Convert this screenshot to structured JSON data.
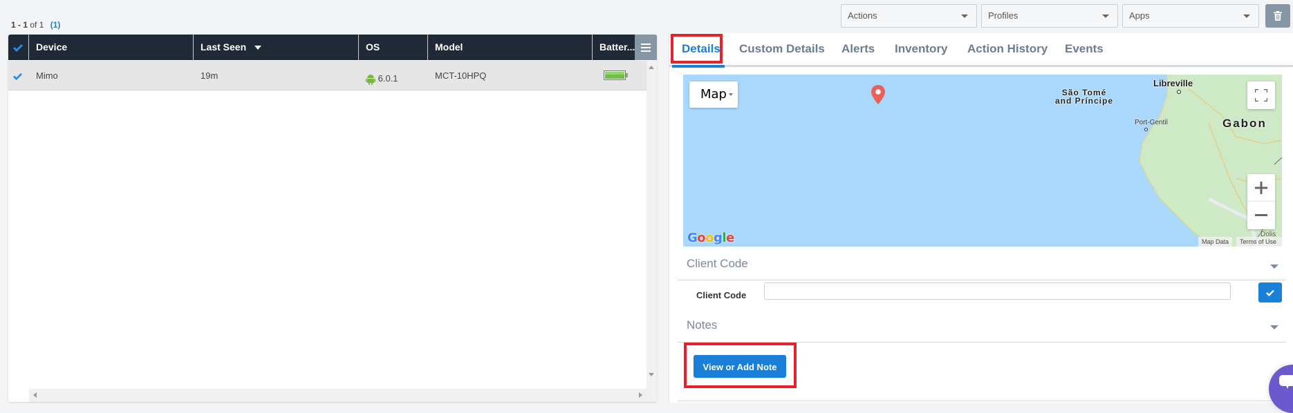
{
  "toolbar": {
    "actions_label": "Actions",
    "profiles_label": "Profiles",
    "apps_label": "Apps",
    "delete_icon": "trash-icon"
  },
  "pagination": {
    "range": "1 - 1",
    "of_text": "of 1",
    "selected_count": "(1)"
  },
  "grid": {
    "columns": [
      {
        "label": "Device"
      },
      {
        "label": "Last Seen",
        "sorted": "desc"
      },
      {
        "label": "OS"
      },
      {
        "label": "Model"
      },
      {
        "label": "Batter..."
      }
    ],
    "rows": [
      {
        "selected": true,
        "device": "Mimo",
        "last_seen": "19m",
        "os_icon": "android-icon",
        "os_version": "6.0.1",
        "model": "MCT-10HPQ",
        "battery_level": 1.0,
        "battery_color": "#6cc04a"
      }
    ]
  },
  "details": {
    "tabs": [
      {
        "label": "Details",
        "active": true
      },
      {
        "label": "Custom Details"
      },
      {
        "label": "Alerts"
      },
      {
        "label": "Inventory"
      },
      {
        "label": "Action History"
      },
      {
        "label": "Events"
      }
    ],
    "map": {
      "type_label": "Map",
      "places": {
        "sao_tome_line1": "São Tomé",
        "sao_tome_line2": "and Príncipe",
        "libreville": "Libreville",
        "port_gentil": "Port-Gentil",
        "gabon": "Gabon",
        "dolisie": "Dolis"
      },
      "footer_map_data": "Map Data",
      "footer_terms": "Terms of Use",
      "logo": "Google"
    },
    "client_code_section": {
      "title": "Client Code",
      "field_label": "Client Code",
      "field_value": ""
    },
    "notes_section": {
      "title": "Notes",
      "button_label": "View or Add Note"
    }
  },
  "colors": {
    "accent": "#1a7fd6",
    "header_bg": "#1f2a36",
    "highlight": "#e8202a",
    "map_water": "#aad8fd"
  }
}
